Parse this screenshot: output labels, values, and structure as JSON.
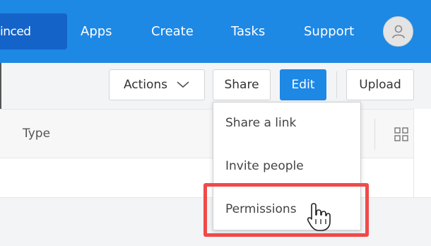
{
  "nav": {
    "active_label": "inced",
    "items": [
      "Apps",
      "Create",
      "Tasks",
      "Support"
    ]
  },
  "toolbar": {
    "actions_label": "Actions",
    "share_label": "Share",
    "edit_label": "Edit",
    "upload_label": "Upload"
  },
  "table": {
    "type_header": "Type"
  },
  "share_menu": {
    "items": [
      "Share a link",
      "Invite people",
      "Permissions"
    ]
  },
  "colors": {
    "topbar": "#1e88e5",
    "active_nav": "#1463c9",
    "edit_button": "#1e88e5",
    "highlight": "#f04a4a"
  },
  "icons": {
    "avatar": "user-icon",
    "actions_dropdown": "chevron-down-icon",
    "view_toggle": "grid-view-icon",
    "cursor": "hand-pointer-icon"
  }
}
